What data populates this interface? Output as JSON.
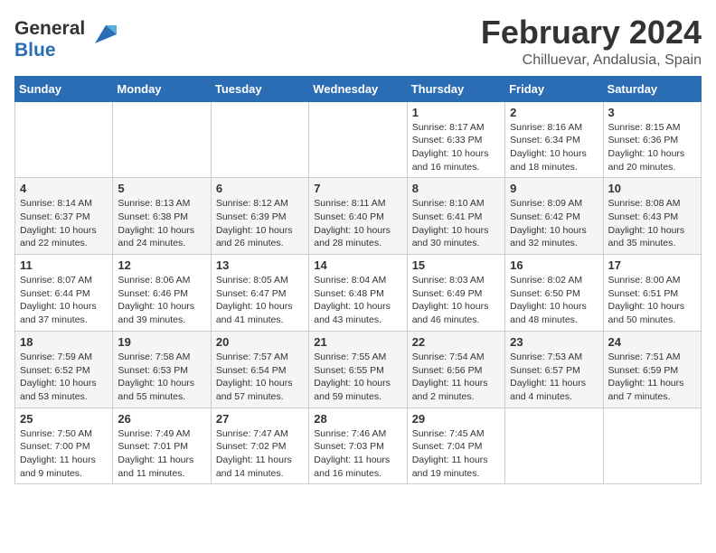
{
  "header": {
    "logo_general": "General",
    "logo_blue": "Blue",
    "title": "February 2024",
    "subtitle": "Chilluevar, Andalusia, Spain"
  },
  "days_of_week": [
    "Sunday",
    "Monday",
    "Tuesday",
    "Wednesday",
    "Thursday",
    "Friday",
    "Saturday"
  ],
  "weeks": [
    {
      "row_class": "row-white",
      "days": [
        {
          "number": "",
          "info": ""
        },
        {
          "number": "",
          "info": ""
        },
        {
          "number": "",
          "info": ""
        },
        {
          "number": "",
          "info": ""
        },
        {
          "number": "1",
          "info": "Sunrise: 8:17 AM\nSunset: 6:33 PM\nDaylight: 10 hours\nand 16 minutes."
        },
        {
          "number": "2",
          "info": "Sunrise: 8:16 AM\nSunset: 6:34 PM\nDaylight: 10 hours\nand 18 minutes."
        },
        {
          "number": "3",
          "info": "Sunrise: 8:15 AM\nSunset: 6:36 PM\nDaylight: 10 hours\nand 20 minutes."
        }
      ]
    },
    {
      "row_class": "row-alt",
      "days": [
        {
          "number": "4",
          "info": "Sunrise: 8:14 AM\nSunset: 6:37 PM\nDaylight: 10 hours\nand 22 minutes."
        },
        {
          "number": "5",
          "info": "Sunrise: 8:13 AM\nSunset: 6:38 PM\nDaylight: 10 hours\nand 24 minutes."
        },
        {
          "number": "6",
          "info": "Sunrise: 8:12 AM\nSunset: 6:39 PM\nDaylight: 10 hours\nand 26 minutes."
        },
        {
          "number": "7",
          "info": "Sunrise: 8:11 AM\nSunset: 6:40 PM\nDaylight: 10 hours\nand 28 minutes."
        },
        {
          "number": "8",
          "info": "Sunrise: 8:10 AM\nSunset: 6:41 PM\nDaylight: 10 hours\nand 30 minutes."
        },
        {
          "number": "9",
          "info": "Sunrise: 8:09 AM\nSunset: 6:42 PM\nDaylight: 10 hours\nand 32 minutes."
        },
        {
          "number": "10",
          "info": "Sunrise: 8:08 AM\nSunset: 6:43 PM\nDaylight: 10 hours\nand 35 minutes."
        }
      ]
    },
    {
      "row_class": "row-white",
      "days": [
        {
          "number": "11",
          "info": "Sunrise: 8:07 AM\nSunset: 6:44 PM\nDaylight: 10 hours\nand 37 minutes."
        },
        {
          "number": "12",
          "info": "Sunrise: 8:06 AM\nSunset: 6:46 PM\nDaylight: 10 hours\nand 39 minutes."
        },
        {
          "number": "13",
          "info": "Sunrise: 8:05 AM\nSunset: 6:47 PM\nDaylight: 10 hours\nand 41 minutes."
        },
        {
          "number": "14",
          "info": "Sunrise: 8:04 AM\nSunset: 6:48 PM\nDaylight: 10 hours\nand 43 minutes."
        },
        {
          "number": "15",
          "info": "Sunrise: 8:03 AM\nSunset: 6:49 PM\nDaylight: 10 hours\nand 46 minutes."
        },
        {
          "number": "16",
          "info": "Sunrise: 8:02 AM\nSunset: 6:50 PM\nDaylight: 10 hours\nand 48 minutes."
        },
        {
          "number": "17",
          "info": "Sunrise: 8:00 AM\nSunset: 6:51 PM\nDaylight: 10 hours\nand 50 minutes."
        }
      ]
    },
    {
      "row_class": "row-alt",
      "days": [
        {
          "number": "18",
          "info": "Sunrise: 7:59 AM\nSunset: 6:52 PM\nDaylight: 10 hours\nand 53 minutes."
        },
        {
          "number": "19",
          "info": "Sunrise: 7:58 AM\nSunset: 6:53 PM\nDaylight: 10 hours\nand 55 minutes."
        },
        {
          "number": "20",
          "info": "Sunrise: 7:57 AM\nSunset: 6:54 PM\nDaylight: 10 hours\nand 57 minutes."
        },
        {
          "number": "21",
          "info": "Sunrise: 7:55 AM\nSunset: 6:55 PM\nDaylight: 10 hours\nand 59 minutes."
        },
        {
          "number": "22",
          "info": "Sunrise: 7:54 AM\nSunset: 6:56 PM\nDaylight: 11 hours\nand 2 minutes."
        },
        {
          "number": "23",
          "info": "Sunrise: 7:53 AM\nSunset: 6:57 PM\nDaylight: 11 hours\nand 4 minutes."
        },
        {
          "number": "24",
          "info": "Sunrise: 7:51 AM\nSunset: 6:59 PM\nDaylight: 11 hours\nand 7 minutes."
        }
      ]
    },
    {
      "row_class": "row-white",
      "days": [
        {
          "number": "25",
          "info": "Sunrise: 7:50 AM\nSunset: 7:00 PM\nDaylight: 11 hours\nand 9 minutes."
        },
        {
          "number": "26",
          "info": "Sunrise: 7:49 AM\nSunset: 7:01 PM\nDaylight: 11 hours\nand 11 minutes."
        },
        {
          "number": "27",
          "info": "Sunrise: 7:47 AM\nSunset: 7:02 PM\nDaylight: 11 hours\nand 14 minutes."
        },
        {
          "number": "28",
          "info": "Sunrise: 7:46 AM\nSunset: 7:03 PM\nDaylight: 11 hours\nand 16 minutes."
        },
        {
          "number": "29",
          "info": "Sunrise: 7:45 AM\nSunset: 7:04 PM\nDaylight: 11 hours\nand 19 minutes."
        },
        {
          "number": "",
          "info": ""
        },
        {
          "number": "",
          "info": ""
        }
      ]
    }
  ]
}
